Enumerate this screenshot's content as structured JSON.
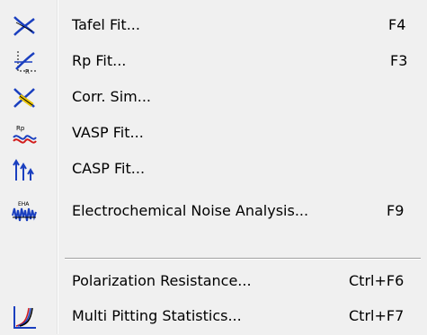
{
  "menu": {
    "items": [
      {
        "label": "Tafel Fit...",
        "shortcut": "F4",
        "icon": "tafel-fit-icon"
      },
      {
        "label": "Rp Fit...",
        "shortcut": "F3",
        "icon": "rp-fit-icon"
      },
      {
        "label": "Corr. Sim...",
        "shortcut": "",
        "icon": "corr-sim-icon"
      },
      {
        "label": "VASP Fit...",
        "shortcut": "",
        "icon": "vasp-fit-icon"
      },
      {
        "label": "CASP Fit...",
        "shortcut": "",
        "icon": "casp-fit-icon"
      },
      {
        "label": "Electrochemical Noise Analysis...",
        "shortcut": "F9",
        "icon": "electrochemical-noise-icon"
      },
      {
        "label": "Polarization Resistance...",
        "shortcut": "Ctrl+F6",
        "icon": ""
      },
      {
        "label": "Multi Pitting Statistics...",
        "shortcut": "Ctrl+F7",
        "icon": "multi-pitting-icon"
      }
    ],
    "colors": {
      "background": "#f0f0f0",
      "icon_blue": "#1a3fbf",
      "icon_red": "#d21a1a",
      "icon_yellow": "#e8c200"
    }
  }
}
